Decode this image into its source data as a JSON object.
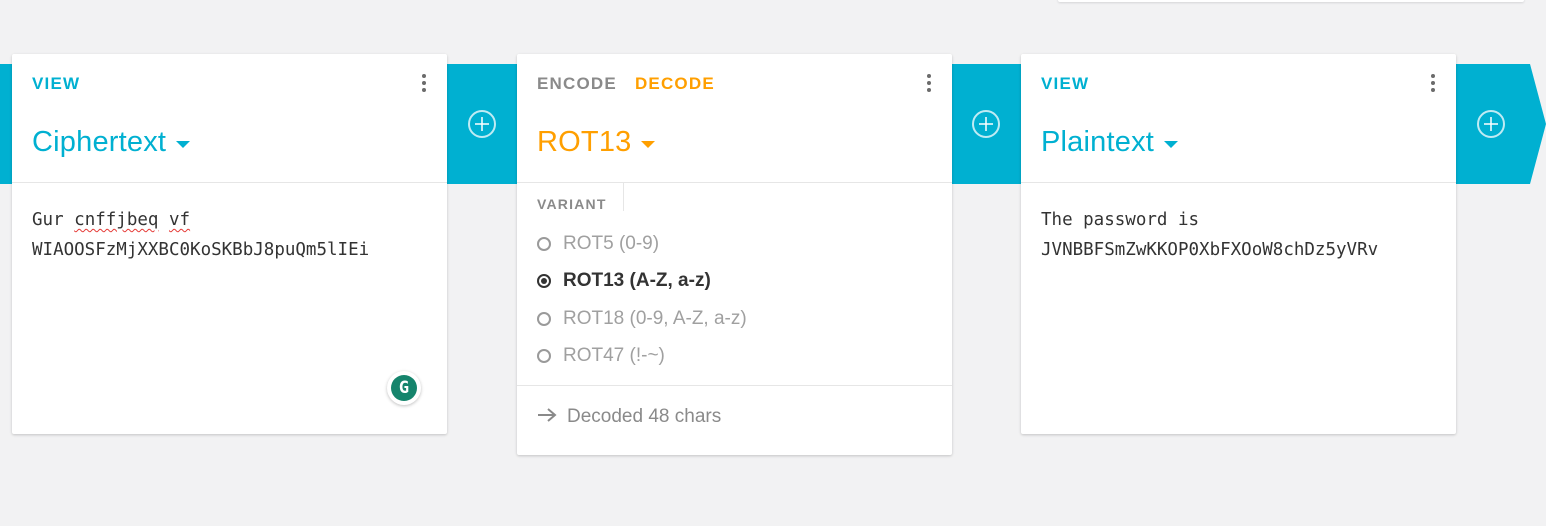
{
  "cards": [
    {
      "tabs": [
        "VIEW"
      ],
      "title": "Ciphertext",
      "text_words": [
        "Gur",
        "cnffjbeq",
        "vf"
      ],
      "text_line2": "WIAOOSFzMjXXBC0KoSKBbJ8puQm5lIEi"
    },
    {
      "tabs": [
        "ENCODE",
        "DECODE"
      ],
      "title": "ROT13",
      "variant_label": "VARIANT",
      "options": [
        {
          "label": "ROT5 (0-9)",
          "selected": false
        },
        {
          "label": "ROT13 (A-Z, a-z)",
          "selected": true
        },
        {
          "label": "ROT18 (0-9, A-Z, a-z)",
          "selected": false
        },
        {
          "label": "ROT47 (!-~)",
          "selected": false
        }
      ],
      "footer": "Decoded 48 chars"
    },
    {
      "tabs": [
        "VIEW"
      ],
      "title": "Plaintext",
      "text_line1": "The password is",
      "text_line2": "JVNBBFSmZwKKOP0XbFXOoW8chDz5yVRv"
    }
  ],
  "grammarly_glyph": "G",
  "colors": {
    "accent": "#00b0d1",
    "active": "#ff9f00",
    "background": "#f2f2f3"
  },
  "icons": [
    "plus-circle-icon",
    "more-vert-icon",
    "caret-down-icon",
    "arrow-right-icon",
    "grammarly-icon"
  ]
}
